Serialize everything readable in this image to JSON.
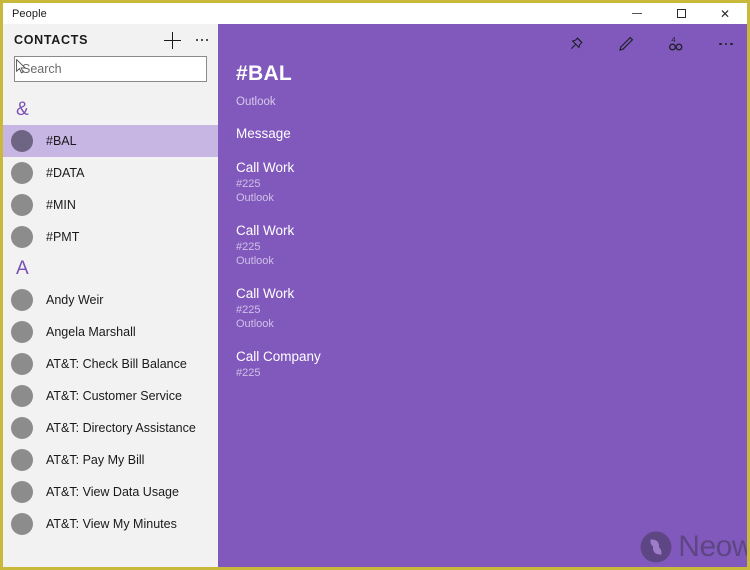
{
  "window": {
    "title": "People",
    "controls": {
      "minimize": "Minimize",
      "maximize": "Maximize",
      "close": "Close"
    },
    "border_color": "#c9b93a"
  },
  "sidebar": {
    "header": {
      "title": "CONTACTS",
      "add_label": "New contact",
      "more_label": "See more"
    },
    "search": {
      "placeholder": "Search",
      "value": ""
    },
    "groups": [
      {
        "letter": "&",
        "contacts": [
          {
            "name": "#BAL",
            "selected": true
          },
          {
            "name": "#DATA",
            "selected": false
          },
          {
            "name": "#MIN",
            "selected": false
          },
          {
            "name": "#PMT",
            "selected": false
          }
        ]
      },
      {
        "letter": "A",
        "contacts": [
          {
            "name": "Andy Weir",
            "selected": false
          },
          {
            "name": "Angela Marshall",
            "selected": false
          },
          {
            "name": "AT&T: Check Bill Balance",
            "selected": false
          },
          {
            "name": "AT&T: Customer Service",
            "selected": false
          },
          {
            "name": "AT&T: Directory Assistance",
            "selected": false
          },
          {
            "name": "AT&T: Pay My Bill",
            "selected": false
          },
          {
            "name": "AT&T: View Data Usage",
            "selected": false
          },
          {
            "name": "AT&T: View My Minutes",
            "selected": false
          }
        ]
      }
    ]
  },
  "detail": {
    "toolbar": {
      "pin_label": "Pin to Start",
      "edit_label": "Edit",
      "link_label": "Link contacts",
      "more_label": "See more"
    },
    "title": "#BAL",
    "source": "Outlook",
    "actions": [
      {
        "title": "Message",
        "sub": "",
        "sub2": ""
      },
      {
        "title": "Call Work",
        "sub": "#225",
        "sub2": "Outlook"
      },
      {
        "title": "Call Work",
        "sub": "#225",
        "sub2": "Outlook"
      },
      {
        "title": "Call Work",
        "sub": "#225",
        "sub2": "Outlook"
      },
      {
        "title": "Call Company",
        "sub": "#225",
        "sub2": ""
      }
    ],
    "accent_color": "#8159bd",
    "selection_color": "#c7b5e4"
  },
  "watermark": {
    "text": "Neow",
    "logo_label": "neowin-logo"
  }
}
